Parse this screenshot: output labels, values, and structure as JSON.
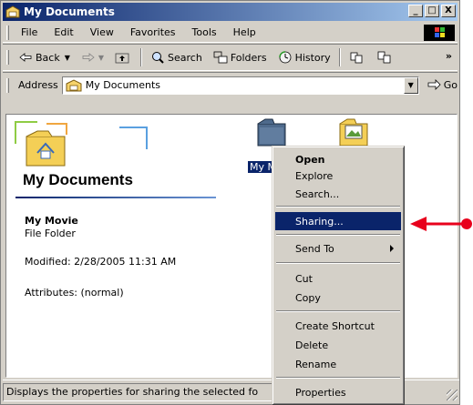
{
  "window": {
    "title": "My Documents",
    "controls": {
      "minimize": "_",
      "maximize": "□",
      "close": "X"
    }
  },
  "menubar": {
    "items": [
      "File",
      "Edit",
      "View",
      "Favorites",
      "Tools",
      "Help"
    ]
  },
  "toolbar": {
    "back": "Back",
    "search": "Search",
    "folders": "Folders",
    "history": "History",
    "more": "»"
  },
  "addressbar": {
    "label": "Address",
    "value": "My Documents",
    "go": "Go"
  },
  "left_pane": {
    "title": "My Documents",
    "selected_name": "My Movie",
    "selected_type": "File Folder",
    "modified": "Modified: 2/28/2005 11:31 AM",
    "attributes": "Attributes: (normal)"
  },
  "files": {
    "selected_label": "My M"
  },
  "context_menu": {
    "items": [
      {
        "label": "Open",
        "bold": true
      },
      {
        "label": "Explore"
      },
      {
        "label": "Search..."
      },
      {
        "label": "Sharing...",
        "selected": true
      },
      {
        "label": "Send To",
        "submenu": true
      },
      {
        "label": "Cut"
      },
      {
        "label": "Copy"
      },
      {
        "label": "Create Shortcut"
      },
      {
        "label": "Delete"
      },
      {
        "label": "Rename"
      },
      {
        "label": "Properties"
      }
    ]
  },
  "statusbar": {
    "text": "Displays the properties for sharing the selected fo"
  },
  "colors": {
    "titlebar_start": "#0a246a",
    "titlebar_end": "#a6caf0",
    "selection": "#0a246a",
    "pointer": "#e8001c",
    "chrome": "#d4d0c8"
  },
  "icons": {
    "title": "folder-home-icon",
    "back": "back-arrow-icon",
    "forward": "forward-arrow-icon",
    "up": "up-folder-icon",
    "search": "search-icon",
    "folders": "folders-icon",
    "history": "history-icon",
    "go": "go-icon",
    "pointer": "red-pointer-arrow-icon"
  }
}
